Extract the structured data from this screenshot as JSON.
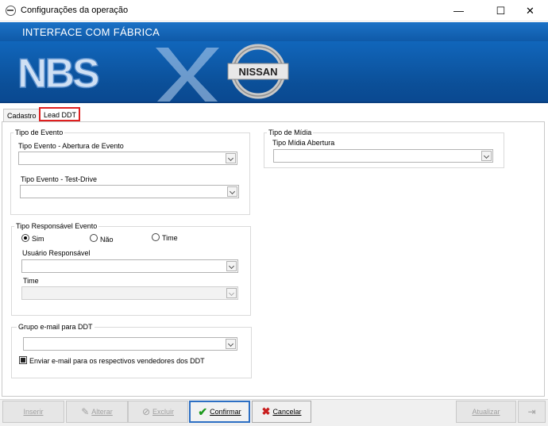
{
  "window": {
    "title": "Configurações da operação",
    "minimize_glyph": "—",
    "maximize_glyph": "☐",
    "close_glyph": "✕"
  },
  "banner": {
    "text": "INTERFACE COM FÁBRICA",
    "logo_left": "NBS",
    "logo_right": "NISSAN"
  },
  "tabs": [
    {
      "label": "Cadastro"
    },
    {
      "label": "Lead DDT"
    }
  ],
  "tipo_evento": {
    "title": "Tipo de Evento",
    "abertura_label": "Tipo Evento - Abertura de Evento",
    "abertura_value": "",
    "testdrive_label": "Tipo Evento - Test-Drive",
    "testdrive_value": ""
  },
  "tipo_midia": {
    "title": "Tipo de Mídia",
    "abertura_label": "Tipo Mídia Abertura",
    "abertura_value": ""
  },
  "tipo_responsavel": {
    "title": "Tipo Responsável Evento",
    "options": [
      {
        "label": "Sim",
        "checked": true
      },
      {
        "label": "Não",
        "checked": false
      },
      {
        "label": "Time",
        "checked": false
      }
    ],
    "usuario_label": "Usuário Responsável",
    "usuario_value": "",
    "time_label": "Time",
    "time_value": ""
  },
  "grupo_email": {
    "title": "Grupo e-mail para DDT",
    "value": "",
    "checkbox_label": "Enviar e-mail para os respectivos vendedores dos DDT",
    "checkbox_checked": true
  },
  "toolbar": {
    "inserir": "Inserir",
    "alterar": "Alterar",
    "excluir": "Excluir",
    "confirmar": "Confirmar",
    "cancelar": "Cancelar",
    "atualizar": "Atualizar"
  },
  "colors": {
    "banner_blue": "#0f5aa8",
    "tab_highlight": "#e02020",
    "confirm_check": "#1e9a1e",
    "cancel_x": "#c81e1e"
  }
}
